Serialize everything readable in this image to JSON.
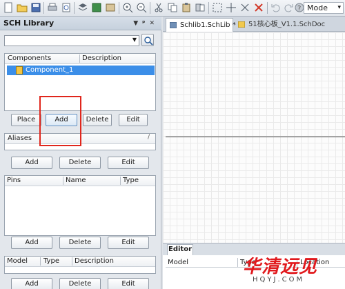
{
  "toolbar": {
    "mode_label": "Mode",
    "icons": [
      "new-icon",
      "open-icon",
      "save-icon",
      "print-icon",
      "print-preview-icon",
      "layers-icon",
      "grid-icon",
      "library-icon",
      "zoom-in-icon",
      "zoom-out-icon",
      "cut-icon",
      "copy-icon",
      "paste-icon",
      "paste-array-icon",
      "select-area-icon",
      "move-icon",
      "cross-icon",
      "clear-filter-icon",
      "undo-icon",
      "redo-icon",
      "help-icon"
    ]
  },
  "panel": {
    "title": "SCH Library",
    "library_select_value": "",
    "components": {
      "headers": [
        "Components",
        "Description"
      ],
      "items": [
        "Component_1"
      ]
    },
    "component_buttons": [
      "Place",
      "Add",
      "Delete",
      "Edit"
    ],
    "aliases": {
      "header": "Aliases"
    },
    "alias_buttons": [
      "Add",
      "Delete",
      "Edit"
    ],
    "pins": {
      "headers": [
        "Pins",
        "Name",
        "Type"
      ]
    },
    "pin_buttons": [
      "Add",
      "Delete",
      "Edit"
    ],
    "models": {
      "headers": [
        "Model",
        "Type",
        "Description"
      ]
    },
    "model_buttons": [
      "Add",
      "Delete",
      "Edit"
    ]
  },
  "tabs": [
    {
      "label": "Schlib1.SchLib *",
      "active": true
    },
    {
      "label": "51核心板_V1.1.SchDoc",
      "active": false
    }
  ],
  "editor": {
    "tab_label": "Editor",
    "headers": [
      "Model",
      "Type",
      "Location"
    ]
  },
  "watermark": {
    "cn": "华清远见",
    "en": "HQYJ.COM"
  },
  "colors": {
    "selection": "#3b8ee8",
    "highlight_box": "#e0261c",
    "watermark": "#e1191d"
  }
}
